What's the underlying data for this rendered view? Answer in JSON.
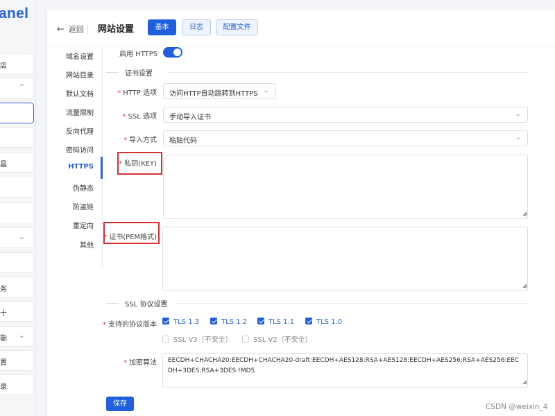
{
  "sidebar": {
    "logo": "anel",
    "items": [
      {
        "label": "店",
        "chevron": ""
      },
      {
        "label": "",
        "chevron": "⌃"
      },
      {
        "label": "",
        "chevron": ""
      },
      {
        "label": "",
        "chevron": ""
      },
      {
        "label": "晶",
        "chevron": ""
      },
      {
        "label": "",
        "chevron": ""
      },
      {
        "label": "",
        "chevron": ""
      },
      {
        "label": "",
        "chevron": "⌄"
      },
      {
        "label": "",
        "chevron": ""
      },
      {
        "label": "务",
        "chevron": ""
      },
      {
        "label": "十",
        "chevron": ""
      },
      {
        "label": "能",
        "chevron": "⌄"
      },
      {
        "label": "置",
        "chevron": ""
      },
      {
        "label": "录",
        "chevron": ""
      }
    ]
  },
  "header": {
    "back_label": "返回",
    "back_icon": "←",
    "title": "网站设置",
    "tabs": [
      "基本",
      "日志",
      "配置文件"
    ]
  },
  "left_nav": [
    "域名设置",
    "网站目录",
    "默认文档",
    "流量限制",
    "反向代理",
    "密码访问",
    "HTTPS",
    "伪静态",
    "防盗链",
    "重定向",
    "其他"
  ],
  "form": {
    "https_label": "启用 HTTPS",
    "cert_section": "证书设置",
    "http_option_label": "HTTP 选项",
    "http_option_value": "访问HTTP自动跳转到HTTPS",
    "ssl_option_label": "SSL 选项",
    "ssl_option_value": "手动导入证书",
    "import_label": "导入方式",
    "import_value": "粘贴代码",
    "key_label": "私钥(KEY)",
    "cert_label": "证书(PEM格式)",
    "protocol_section": "SSL 协议设置",
    "protocols_label": "支持的协议版本",
    "protocols": [
      {
        "label": "TLS 1.3",
        "checked": true
      },
      {
        "label": "TLS 1.2",
        "checked": true
      },
      {
        "label": "TLS 1.1",
        "checked": true
      },
      {
        "label": "TLS 1.0",
        "checked": true
      },
      {
        "label": "SSL V3（不安全）",
        "checked": false
      },
      {
        "label": "SSL V2（不安全）",
        "checked": false
      }
    ],
    "cipher_label": "加密算法",
    "cipher_value": "EECDH+CHACHA20:EECDH+CHACHA20-draft:EECDH+AES128:RSA+AES128:EECDH+AES256:RSA+AES256:EECDH+3DES:RSA+3DES:!MD5",
    "save_label": "保存"
  },
  "watermark": "CSDN @weixin_4",
  "colors": {
    "accent": "#1f5fdc",
    "highlight_box": "#d32f2f"
  }
}
